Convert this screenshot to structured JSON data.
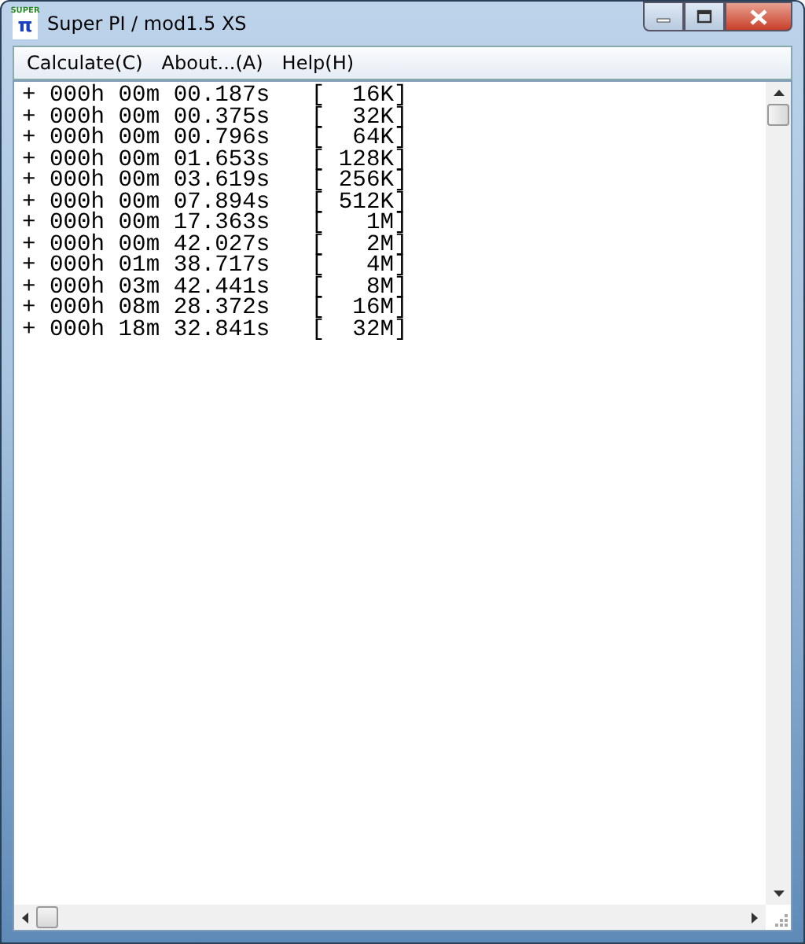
{
  "window": {
    "title": "Super PI / mod1.5 XS",
    "icon_text": "SUPER",
    "icon_symbol": "π"
  },
  "menu": [
    "Calculate(C)",
    "About...(A)",
    "Help(H)"
  ],
  "lines": [
    "+ 000h 00m 00.187s   [  16K]",
    "+ 000h 00m 00.375s   [  32K]",
    "+ 000h 00m 00.796s   [  64K]",
    "+ 000h 00m 01.653s   [ 128K]",
    "+ 000h 00m 03.619s   [ 256K]",
    "+ 000h 00m 07.894s   [ 512K]",
    "+ 000h 00m 17.363s   [   1M]",
    "+ 000h 00m 42.027s   [   2M]",
    "+ 000h 01m 38.717s   [   4M]",
    "+ 000h 03m 42.441s   [   8M]",
    "+ 000h 08m 28.372s   [  16M]",
    "+ 000h 18m 32.841s   [  32M]"
  ]
}
